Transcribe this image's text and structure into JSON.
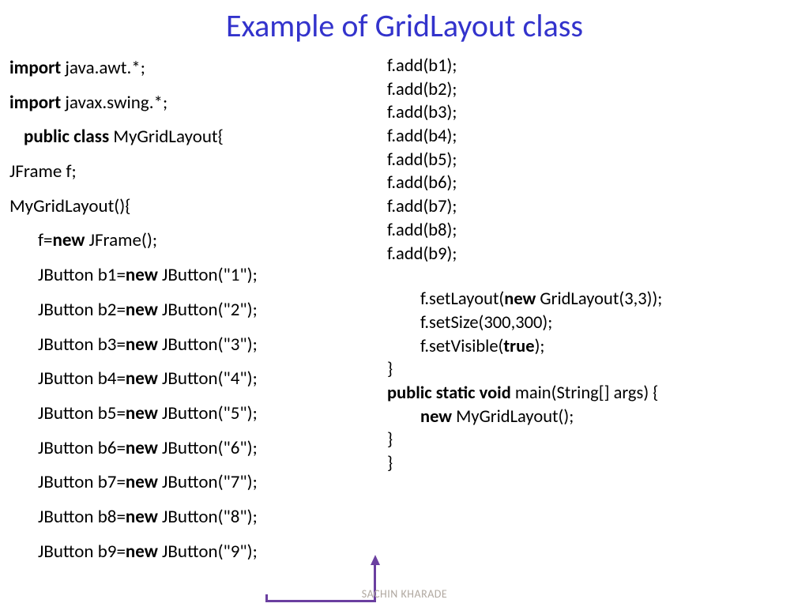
{
  "title": "Example of GridLayout class",
  "left": {
    "l1a": "import",
    "l1b": " java.awt.*;",
    "l2a": "import",
    "l2b": " javax.swing.*;",
    "l3a": "public class",
    "l3b": " MyGridLayout{",
    "l4": "JFrame f;",
    "l5": "MyGridLayout(){",
    "l6a": "f=",
    "l6b": "new",
    "l6c": " JFrame();",
    "l7a": "JButton b1=",
    "l7b": "new",
    "l7c": " JButton(\"1\");",
    "l8a": "JButton b2=",
    "l8b": "new",
    "l8c": " JButton(\"2\");",
    "l9a": "JButton b3=",
    "l9b": "new",
    "l9c": " JButton(\"3\");",
    "l10a": "JButton b4=",
    "l10b": "new",
    "l10c": " JButton(\"4\");",
    "l11a": "JButton b5=",
    "l11b": "new",
    "l11c": " JButton(\"5\");",
    "l12a": "JButton b6=",
    "l12b": "new",
    "l12c": " JButton(\"6\");",
    "l13a": "JButton b7=",
    "l13b": "new",
    "l13c": " JButton(\"7\");",
    "l14a": "JButton b8=",
    "l14b": "new",
    "l14c": " JButton(\"8\");",
    "l15a": "JButton b9=",
    "l15b": "new",
    "l15c": " JButton(\"9\");"
  },
  "right": {
    "r1": "f.add(b1);",
    "r2": "f.add(b2);",
    "r3": "f.add(b3);",
    "r4": "f.add(b4);",
    "r5": "f.add(b5);",
    "r6": "f.add(b6);",
    "r7": "f.add(b7);",
    "r8": "f.add(b8);",
    "r9": "f.add(b9);",
    "r10a": "f.setLayout(",
    "r10b": "new",
    "r10c": " GridLayout(3,3));",
    "r11": "f.setSize(300,300);",
    "r12a": "f.setVisible(",
    "r12b": "true",
    "r12c": ");",
    "r13": "}",
    "r14a": "public static void",
    "r14b": " main(String[] args) {",
    "r15a": "new",
    "r15b": " MyGridLayout();",
    "r16": "}",
    "r17": "}"
  },
  "footer": "SACHIN KHARADE"
}
